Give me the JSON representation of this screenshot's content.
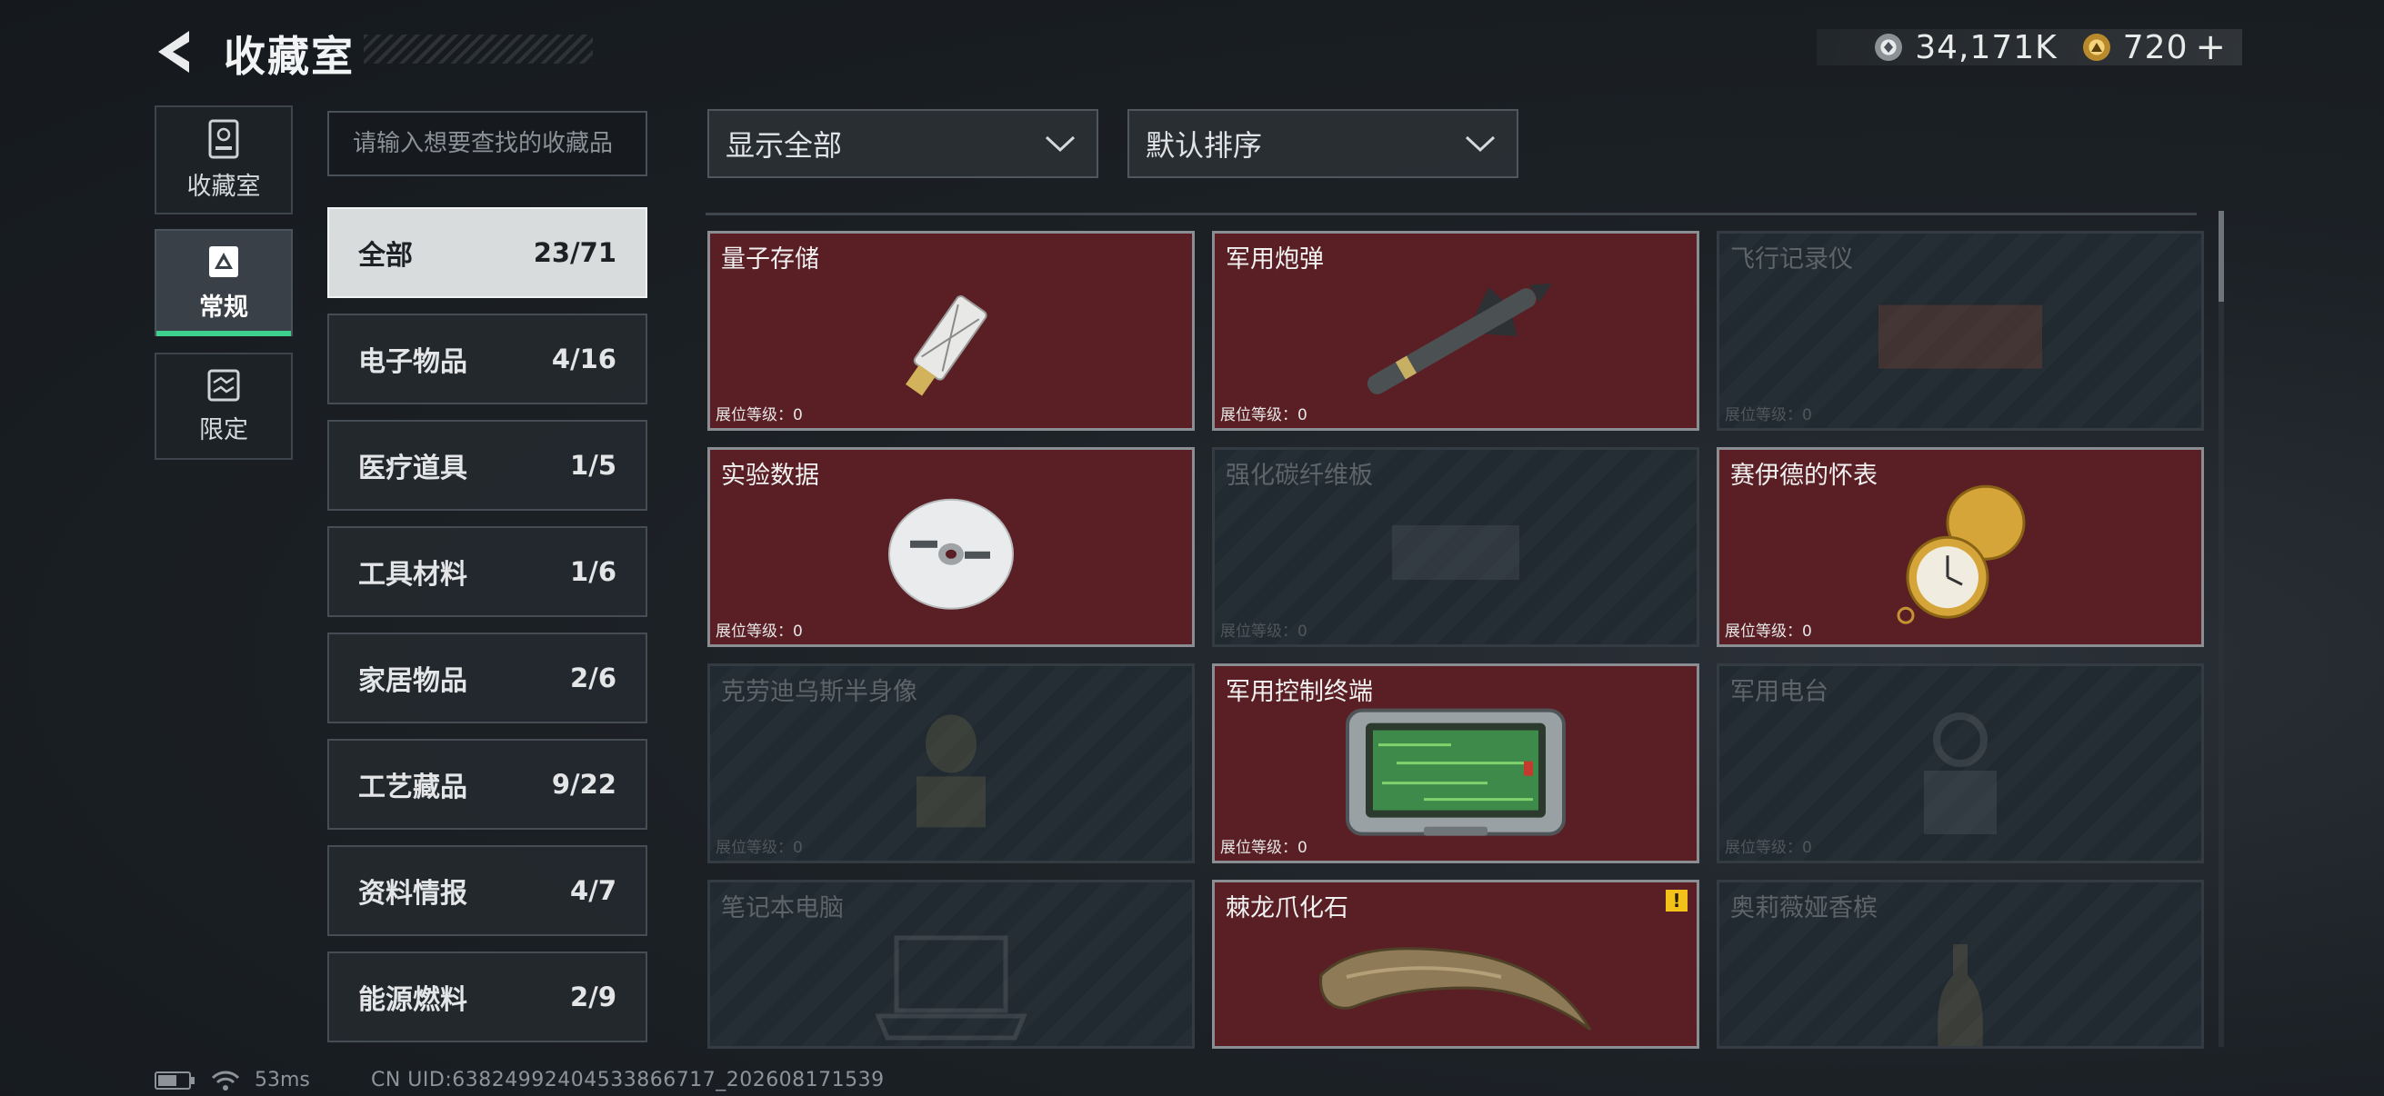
{
  "header": {
    "title": "收藏室",
    "currency": [
      {
        "icon": "silver-coin-icon",
        "value": "34,171K"
      },
      {
        "icon": "gold-coin-icon",
        "value": "720",
        "plus": "+"
      }
    ]
  },
  "side_tabs": [
    {
      "label": "收藏室",
      "icon": "collection-room-icon",
      "active": false
    },
    {
      "label": "常规",
      "icon": "regular-icon",
      "active": true
    },
    {
      "label": "限定",
      "icon": "limited-icon",
      "active": false
    }
  ],
  "search": {
    "placeholder": "请输入想要查找的收藏品",
    "value": ""
  },
  "categories": [
    {
      "name": "全部",
      "count": "23/71",
      "active": true
    },
    {
      "name": "电子物品",
      "count": "4/16"
    },
    {
      "name": "医疗道具",
      "count": "1/5"
    },
    {
      "name": "工具材料",
      "count": "1/6"
    },
    {
      "name": "家居物品",
      "count": "2/6"
    },
    {
      "name": "工艺藏品",
      "count": "9/22"
    },
    {
      "name": "资料情报",
      "count": "4/7"
    },
    {
      "name": "能源燃料",
      "count": "2/9"
    }
  ],
  "filters": {
    "display": "显示全部",
    "sort": "默认排序"
  },
  "items": [
    {
      "name": "量子存储",
      "info": "展位等级：0",
      "owned": true,
      "icon": "usb-drive-icon"
    },
    {
      "name": "军用炮弹",
      "info": "展位等级：0",
      "owned": true,
      "icon": "missile-icon"
    },
    {
      "name": "飞行记录仪",
      "info": "展位等级：0",
      "owned": false,
      "icon": "flight-recorder-icon"
    },
    {
      "name": "实验数据",
      "info": "展位等级：0",
      "owned": true,
      "icon": "disc-icon"
    },
    {
      "name": "强化碳纤维板",
      "info": "展位等级：0",
      "owned": false,
      "icon": "carbon-plate-icon"
    },
    {
      "name": "赛伊德的怀表",
      "info": "展位等级：0",
      "owned": true,
      "icon": "pocket-watch-icon"
    },
    {
      "name": "克劳迪乌斯半身像",
      "info": "展位等级：0",
      "owned": false,
      "icon": "bust-icon"
    },
    {
      "name": "军用控制终端",
      "info": "展位等级：0",
      "owned": true,
      "icon": "control-terminal-icon"
    },
    {
      "name": "军用电台",
      "info": "展位等级：0",
      "owned": false,
      "icon": "radio-icon"
    },
    {
      "name": "笔记本电脑",
      "info": "",
      "owned": false,
      "icon": "laptop-icon"
    },
    {
      "name": "棘龙爪化石",
      "info": "",
      "owned": true,
      "icon": "claw-fossil-icon",
      "alert": "!"
    },
    {
      "name": "奥莉薇娅香槟",
      "info": "",
      "owned": false,
      "icon": "champagne-icon"
    }
  ],
  "status": {
    "ping": "53ms",
    "uid": "CN UID:63824992404533866717_202608171539"
  }
}
